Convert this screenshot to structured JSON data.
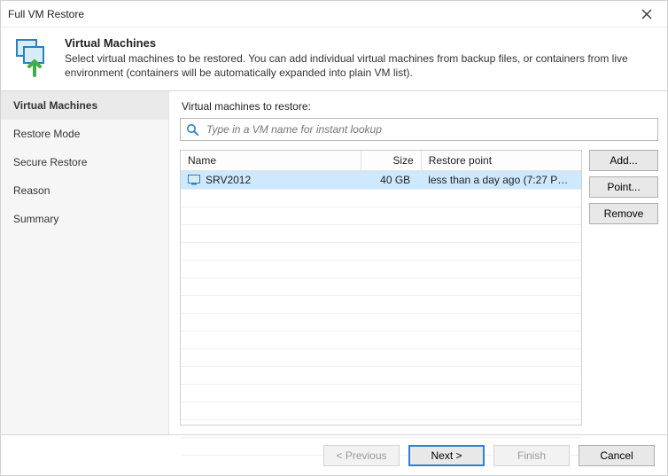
{
  "window": {
    "title": "Full VM Restore"
  },
  "header": {
    "heading": "Virtual Machines",
    "description": "Select virtual machines to be restored. You can add individual virtual machines from backup files, or containers from live environment (containers will be automatically expanded into plain VM list)."
  },
  "sidebar": {
    "items": [
      {
        "label": "Virtual Machines",
        "active": true
      },
      {
        "label": "Restore Mode",
        "active": false
      },
      {
        "label": "Secure Restore",
        "active": false
      },
      {
        "label": "Reason",
        "active": false
      },
      {
        "label": "Summary",
        "active": false
      }
    ]
  },
  "main": {
    "list_label": "Virtual machines to restore:",
    "search_placeholder": "Type in a VM name for instant lookup",
    "columns": {
      "name": "Name",
      "size": "Size",
      "restore_point": "Restore point"
    },
    "rows": [
      {
        "name": "SRV2012",
        "size": "40 GB",
        "restore_point": "less than a day ago (7:27 PM ...",
        "selected": true
      }
    ],
    "empty_row_count": 15
  },
  "side_buttons": {
    "add": "Add...",
    "point": "Point...",
    "remove": "Remove"
  },
  "footer": {
    "previous": "< Previous",
    "next": "Next >",
    "finish": "Finish",
    "cancel": "Cancel"
  },
  "icons": {
    "vm_icon": "vm-icon",
    "search_icon": "search-icon",
    "restore_icon": "vm-restore-icon",
    "close_icon": "close-icon"
  }
}
